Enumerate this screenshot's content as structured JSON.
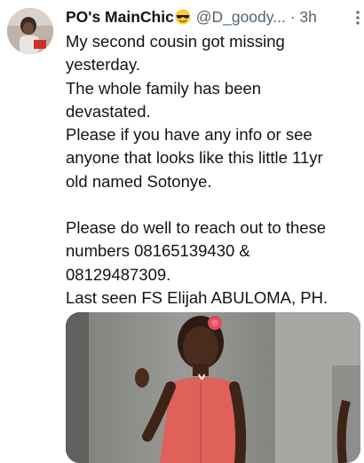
{
  "tweet": {
    "display_name": "PO's MainChic",
    "emoji_icon": "sunglasses-face-icon",
    "handle": "@D_goody...",
    "separator": "·",
    "time": "3h",
    "more_icon": "vertical-ellipsis-icon",
    "text_lines_block1": [
      "My second cousin got missing",
      "yesterday.",
      "The whole family has been",
      "devastated.",
      "Please if you have any info or see",
      "anyone that looks like this little 11yr",
      "old named Sotonye."
    ],
    "text_lines_block2": [
      "Please do well to reach out to these",
      "numbers 08165139430 &",
      "08129487309.",
      "Last seen FS Elijah ABULOMA, PH."
    ]
  },
  "colors": {
    "text": "#0f1419",
    "secondary": "#536471",
    "dress": "#e0605a"
  }
}
